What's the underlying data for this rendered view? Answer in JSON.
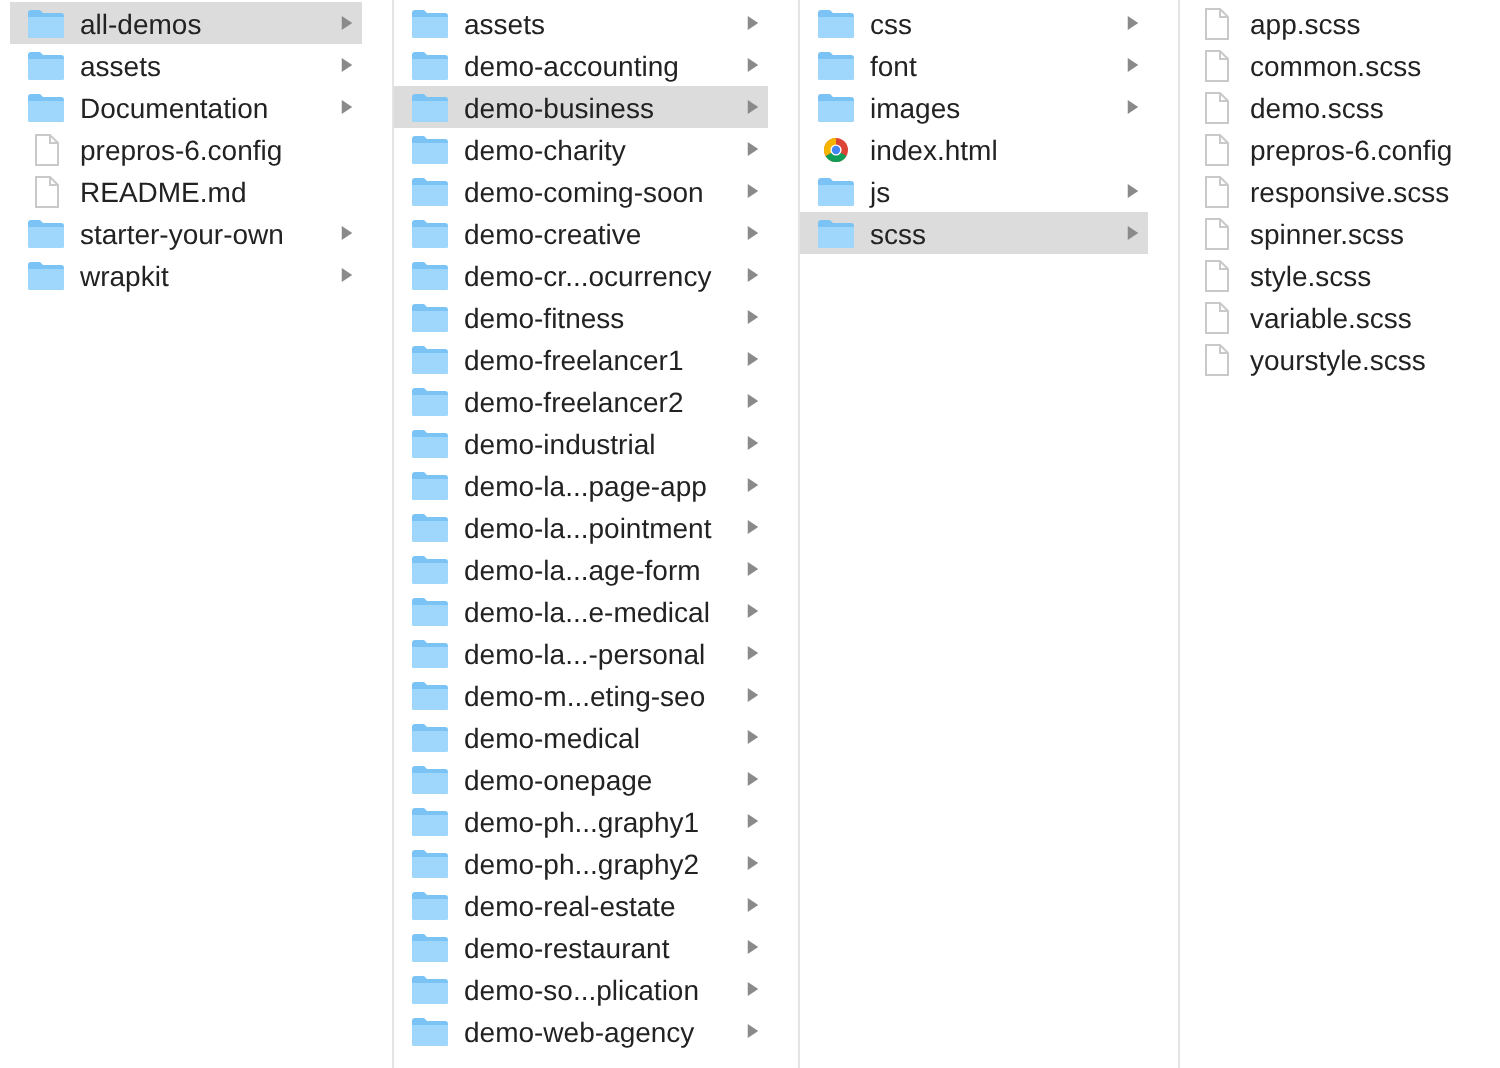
{
  "columns": [
    {
      "items": [
        {
          "name": "all-demos",
          "kind": "folder",
          "selected": true
        },
        {
          "name": "assets",
          "kind": "folder",
          "selected": false
        },
        {
          "name": "Documentation",
          "kind": "folder",
          "selected": false
        },
        {
          "name": "prepros-6.config",
          "kind": "file",
          "selected": false
        },
        {
          "name": "README.md",
          "kind": "file",
          "selected": false
        },
        {
          "name": "starter-your-own",
          "kind": "folder",
          "selected": false
        },
        {
          "name": "wrapkit",
          "kind": "folder",
          "selected": false
        }
      ]
    },
    {
      "items": [
        {
          "name": "assets",
          "kind": "folder",
          "selected": false
        },
        {
          "name": "demo-accounting",
          "kind": "folder",
          "selected": false
        },
        {
          "name": "demo-business",
          "kind": "folder",
          "selected": true
        },
        {
          "name": "demo-charity",
          "kind": "folder",
          "selected": false
        },
        {
          "name": "demo-coming-soon",
          "kind": "folder",
          "selected": false
        },
        {
          "name": "demo-creative",
          "kind": "folder",
          "selected": false
        },
        {
          "name": "demo-cr...ocurrency",
          "kind": "folder",
          "selected": false
        },
        {
          "name": "demo-fitness",
          "kind": "folder",
          "selected": false
        },
        {
          "name": "demo-freelancer1",
          "kind": "folder",
          "selected": false
        },
        {
          "name": "demo-freelancer2",
          "kind": "folder",
          "selected": false
        },
        {
          "name": "demo-industrial",
          "kind": "folder",
          "selected": false
        },
        {
          "name": "demo-la...page-app",
          "kind": "folder",
          "selected": false
        },
        {
          "name": "demo-la...pointment",
          "kind": "folder",
          "selected": false
        },
        {
          "name": "demo-la...age-form",
          "kind": "folder",
          "selected": false
        },
        {
          "name": "demo-la...e-medical",
          "kind": "folder",
          "selected": false
        },
        {
          "name": "demo-la...-personal",
          "kind": "folder",
          "selected": false
        },
        {
          "name": "demo-m...eting-seo",
          "kind": "folder",
          "selected": false
        },
        {
          "name": "demo-medical",
          "kind": "folder",
          "selected": false
        },
        {
          "name": "demo-onepage",
          "kind": "folder",
          "selected": false
        },
        {
          "name": "demo-ph...graphy1",
          "kind": "folder",
          "selected": false
        },
        {
          "name": "demo-ph...graphy2",
          "kind": "folder",
          "selected": false
        },
        {
          "name": "demo-real-estate",
          "kind": "folder",
          "selected": false
        },
        {
          "name": "demo-restaurant",
          "kind": "folder",
          "selected": false
        },
        {
          "name": "demo-so...plication",
          "kind": "folder",
          "selected": false
        },
        {
          "name": "demo-web-agency",
          "kind": "folder",
          "selected": false
        }
      ]
    },
    {
      "items": [
        {
          "name": "css",
          "kind": "folder",
          "selected": false
        },
        {
          "name": "font",
          "kind": "folder",
          "selected": false
        },
        {
          "name": "images",
          "kind": "folder",
          "selected": false
        },
        {
          "name": "index.html",
          "kind": "html",
          "selected": false
        },
        {
          "name": "js",
          "kind": "folder",
          "selected": false
        },
        {
          "name": "scss",
          "kind": "folder",
          "selected": true
        }
      ]
    },
    {
      "items": [
        {
          "name": "app.scss",
          "kind": "file",
          "selected": false
        },
        {
          "name": "common.scss",
          "kind": "file",
          "selected": false
        },
        {
          "name": "demo.scss",
          "kind": "file",
          "selected": false
        },
        {
          "name": "prepros-6.config",
          "kind": "file",
          "selected": false
        },
        {
          "name": "responsive.scss",
          "kind": "file",
          "selected": false
        },
        {
          "name": "spinner.scss",
          "kind": "file",
          "selected": false
        },
        {
          "name": "style.scss",
          "kind": "file",
          "selected": false
        },
        {
          "name": "variable.scss",
          "kind": "file",
          "selected": false
        },
        {
          "name": "yourstyle.scss",
          "kind": "file",
          "selected": false
        }
      ]
    }
  ]
}
